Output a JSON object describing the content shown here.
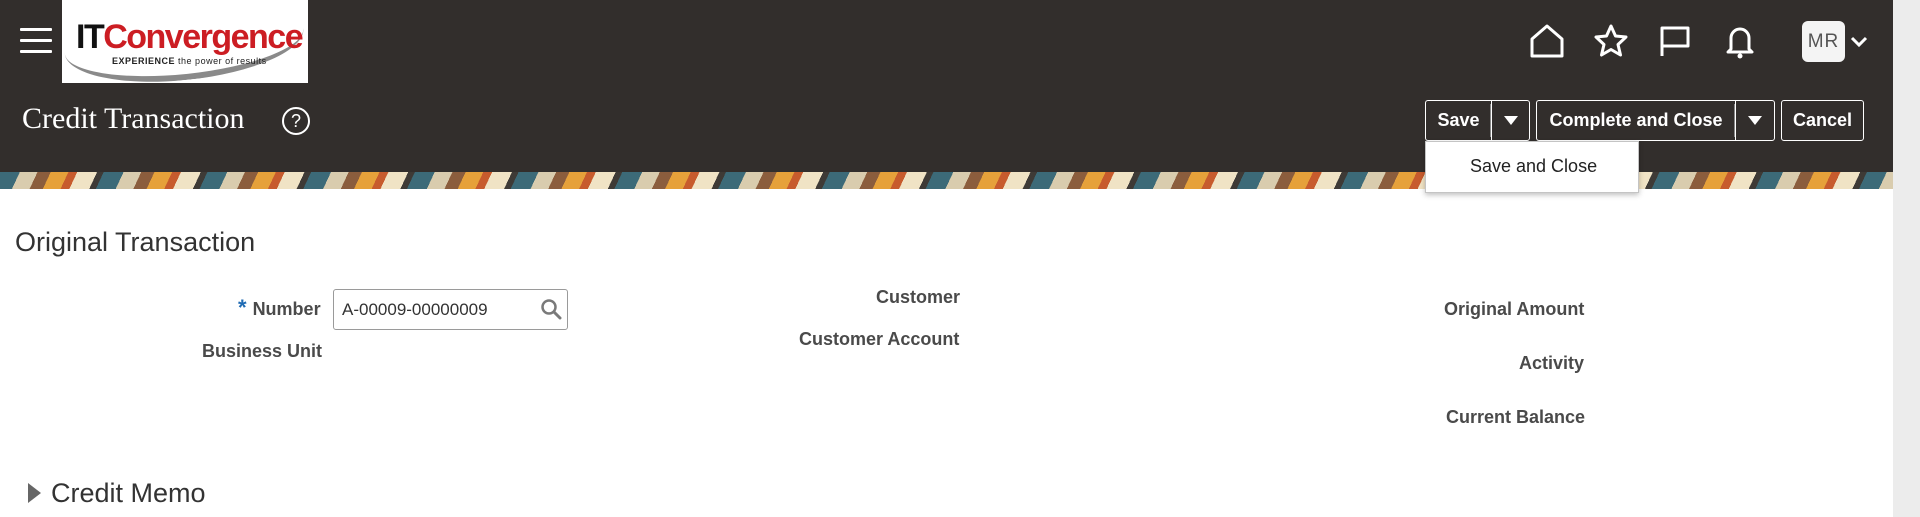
{
  "header": {
    "menu_icon": "hamburger-menu-icon",
    "logo": {
      "brand_it": "IT",
      "brand_rest": "Convergence",
      "tagline_bold": "EXPERIENCE",
      "tagline_rest": "the power of results"
    },
    "icons": [
      "home-icon",
      "favorites-star-icon",
      "flag-icon",
      "notifications-bell-icon"
    ],
    "user_initials": "MR",
    "bg_color": "#322e2c"
  },
  "page": {
    "title": "Credit Transaction",
    "help": "?"
  },
  "toolbar": {
    "save_label": "Save",
    "complete_label": "Complete and Close",
    "cancel_label": "Cancel",
    "save_menu_items": [
      "Save and Close"
    ]
  },
  "original_transaction": {
    "section_title": "Original Transaction",
    "number_label": "Number",
    "required_marker": "*",
    "number_value": "A-00009-00000009",
    "business_unit_label": "Business Unit",
    "customer_label": "Customer",
    "customer_account_label": "Customer Account",
    "original_amount_label": "Original Amount",
    "activity_label": "Activity",
    "current_balance_label": "Current Balance"
  },
  "credit_memo": {
    "section_title": "Credit Memo"
  }
}
